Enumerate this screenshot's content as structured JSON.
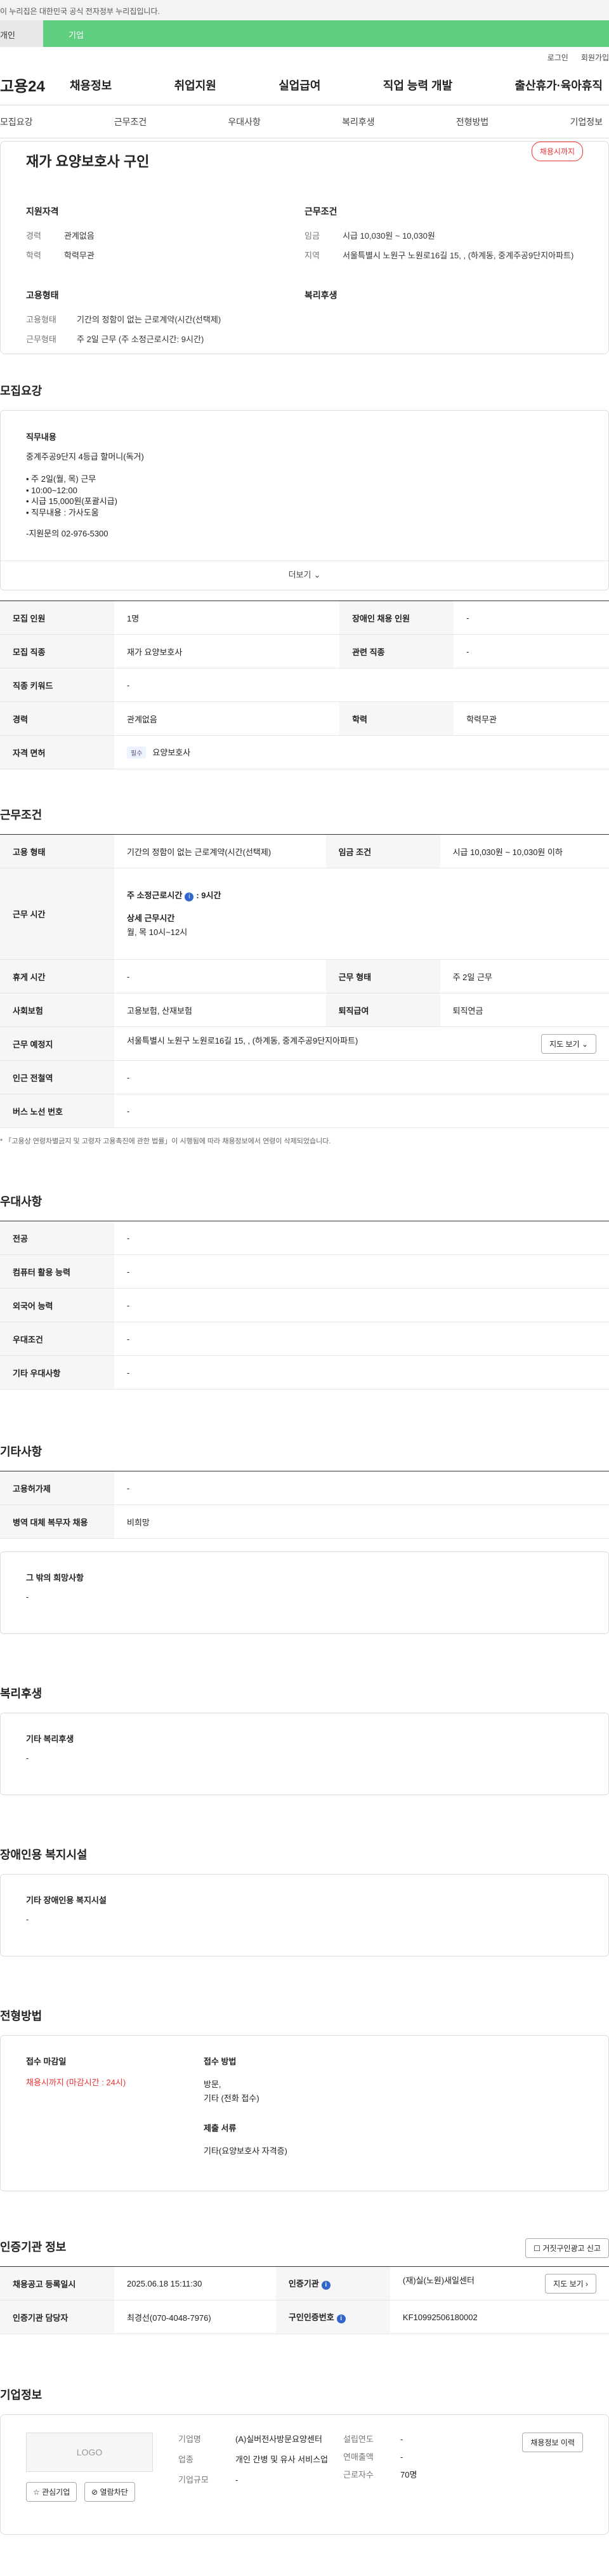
{
  "gov_banner": "이 누리집은 대한민국 공식 전자정부 누리집입니다.",
  "top_tabs": [
    "개인",
    "기업"
  ],
  "util": [
    "로그인",
    "회원가입"
  ],
  "logo": "고용24",
  "gnb": [
    "채용정보",
    "취업지원",
    "실업급여",
    "직업 능력 개발",
    "출산휴가·육아휴직"
  ],
  "subnav": [
    "모집요강",
    "근무조건",
    "우대사항",
    "복리후생",
    "전형방법",
    "기업정보"
  ],
  "job": {
    "title": "재가 요양보호사 구인",
    "status": "채용시까지",
    "qual_title": "지원자격",
    "cond_title": "근무조건",
    "type_title": "고용형태",
    "welfare_title": "복리후생",
    "qual": [
      {
        "k": "경력",
        "v": "관계없음"
      },
      {
        "k": "학력",
        "v": "학력무관"
      }
    ],
    "cond": [
      {
        "k": "임금",
        "v": "시급 10,030원 ~ 10,030원"
      },
      {
        "k": "지역",
        "v": "서울특별시 노원구 노원로16길 15, , (하계동, 중계주공9단지아파트)"
      }
    ],
    "type": [
      {
        "k": "고용형태",
        "v": "기간의 정함이 없는 근로계약(시간(선택제)"
      },
      {
        "k": "근무형태",
        "v": "주 2일 근무 (주 소정근로시간: 9시간)"
      }
    ]
  },
  "recruit": {
    "title": "모집요강",
    "detail_title": "직무내용",
    "detail_lines": [
      "중계주공9단지 4등급 할머니(독거)",
      "",
      "• 주 2일(월, 목) 근무",
      "• 10:00~12:00",
      "• 시급 15,000원(포괄시급)",
      "• 직무내용 : 가사도움",
      "",
      "-지원문의 02-976-5300"
    ],
    "more": "더보기",
    "rows": [
      [
        "모집 인원",
        "1명",
        "장애인 채용 인원",
        "-"
      ],
      [
        "모집 직종",
        "재가 요양보호사",
        "관련 직종",
        "-"
      ],
      [
        "직종 키워드",
        "-"
      ],
      [
        "경력",
        "관계없음",
        "학력",
        "학력무관"
      ]
    ],
    "license_label": "자격 면허",
    "license_tag": "필수",
    "license_value": "요양보호사"
  },
  "work": {
    "title": "근무조건",
    "rows": [
      [
        "고용 형태",
        "기간의 정함이 없는 근로계약(시간(선택제)",
        "임금 조건",
        "시급 10,030원 ~ 10,030원 이하"
      ]
    ],
    "hours_label": "근무 시간",
    "hours_main": "주 소정근로시간",
    "hours_main_val": ": 9시간",
    "hours_detail_label": "상세 근무시간",
    "hours_detail": "월, 목 10시~12시",
    "rows2": [
      [
        "휴게 시간",
        "-",
        "근무 형태",
        "주 2일 근무"
      ],
      [
        "사회보험",
        "고용보험, 산재보험",
        "퇴직급여",
        "퇴직연금"
      ]
    ],
    "place_label": "근무 예정지",
    "place": "서울특별시 노원구 노원로16길 15, , (하계동, 중계주공9단지아파트)",
    "map_btn": "지도 보기",
    "rows3": [
      [
        "인근 전철역",
        "-"
      ],
      [
        "버스 노선 번호",
        "-"
      ]
    ],
    "note": "* 「고용상 연령차별금지 및 고령자 고용촉진에 관한 법률」이 시행됨에 따라 채용정보에서 연령이 삭제되었습니다."
  },
  "pref": {
    "title": "우대사항",
    "rows": [
      [
        "전공",
        "-"
      ],
      [
        "컴퓨터 활용 능력",
        "-"
      ],
      [
        "외국어 능력",
        "-"
      ],
      [
        "우대조건",
        "-"
      ],
      [
        "기타 우대사항",
        "-"
      ]
    ]
  },
  "etc": {
    "title": "기타사항",
    "rows": [
      [
        "고용허가제",
        "-"
      ],
      [
        "병역 대체 복무자 채용",
        "비희망"
      ]
    ],
    "other_label": "그 밖의 희망사항",
    "other_val": "-"
  },
  "welfare": {
    "title": "복리후생",
    "label": "기타 복리후생",
    "val": "-"
  },
  "disabled": {
    "title": "장애인용 복지시설",
    "label": "기타 장애인용 복지시설",
    "val": "-"
  },
  "selection": {
    "title": "전형방법",
    "deadline_label": "접수 마감일",
    "deadline_val": "채용시까지 (마감시간 : 24시)",
    "method_label": "접수 방법",
    "method_val1": "방문,",
    "method_val2": "기타 (전화 접수)",
    "docs_label": "제출 서류",
    "docs_val": "기타(요양보호사 자격증)"
  },
  "agency": {
    "title": "인증기관 정보",
    "report_btn": "거짓구인광고 신고",
    "r1": [
      "채용공고 등록일시",
      "2025.06.18 15:11:30",
      "인증기관",
      "(재)실(노원)새일센터"
    ],
    "view_btn": "지도 보기",
    "r2": [
      "인증기관 담당자",
      "최경선(070-4048-7976)",
      "구인인증번호",
      "KF10992506180002"
    ]
  },
  "company": {
    "title": "기업정보",
    "logo": "LOGO",
    "fav": "관심기업",
    "block": "열람차단",
    "f": [
      [
        "기업명",
        "(A)실버전사방문요양센터"
      ],
      [
        "업종",
        "개인 간병 및 유사 서비스업"
      ],
      [
        "기업규모",
        "-"
      ]
    ],
    "g": [
      [
        "설립연도",
        "-"
      ],
      [
        "연매출액",
        "-"
      ],
      [
        "근로자수",
        "70명"
      ]
    ],
    "more_btn": "채용정보 이력"
  }
}
